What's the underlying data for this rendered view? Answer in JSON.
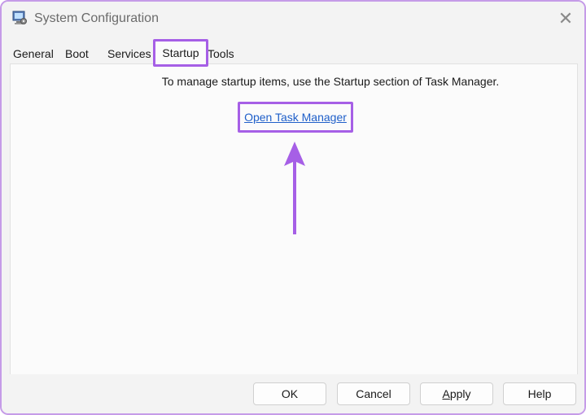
{
  "window": {
    "title": "System Configuration",
    "close_glyph": "✕"
  },
  "tabs": [
    {
      "label": "General",
      "selected": false
    },
    {
      "label": "Boot",
      "selected": false
    },
    {
      "label": "Services",
      "selected": false
    },
    {
      "label": "Startup",
      "selected": true
    },
    {
      "label": "Tools",
      "selected": false
    }
  ],
  "startup": {
    "message": "To manage startup items, use the Startup section of Task Manager.",
    "link_text": "Open Task Manager"
  },
  "buttons": {
    "ok": "OK",
    "cancel": "Cancel",
    "apply_accel": "A",
    "apply_rest": "pply",
    "help": "Help"
  },
  "colors": {
    "highlight": "#a65fe6",
    "link": "#1f5fc9",
    "arrow": "#a65fe6"
  },
  "icons": {
    "app": "system-configuration-icon",
    "close": "close-icon",
    "annotation": "up-arrow-annotation"
  }
}
